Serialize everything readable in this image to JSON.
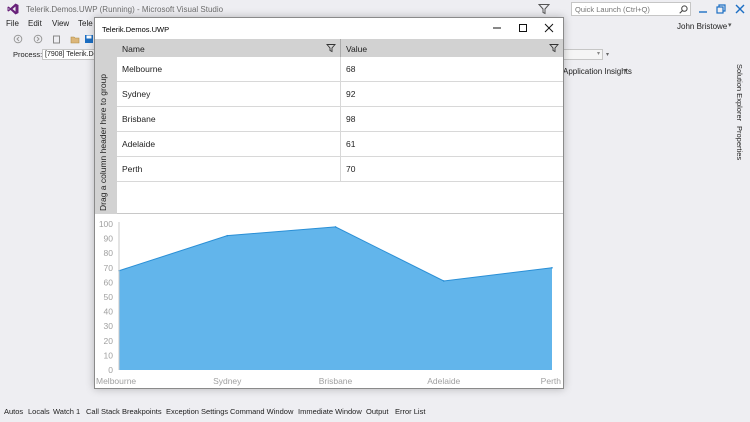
{
  "vs": {
    "title": "Telerik.Demos.UWP (Running) - Microsoft Visual Studio",
    "quick_launch_placeholder": "Quick Launch (Ctrl+Q)",
    "user": "John Bristowe",
    "menu": [
      "File",
      "Edit",
      "View",
      "Tele"
    ],
    "toolbar_partial_label": "Application Insights",
    "process_label": "Process:",
    "process_value": "[7908] Telerik.De",
    "side_tabs": [
      "Solution Explorer",
      "Properties"
    ],
    "bottom_tabs": [
      "Autos",
      "Locals",
      "Watch 1",
      "Call Stack",
      "Breakpoints",
      "Exception Settings",
      "Command Window",
      "Immediate Window",
      "Output",
      "Error List"
    ]
  },
  "app": {
    "title": "Telerik.Demos.UWP",
    "group_panel_text": "Drag a column header here to group",
    "grid": {
      "columns": [
        "Name",
        "Value"
      ],
      "rows": [
        [
          "Melbourne",
          "68"
        ],
        [
          "Sydney",
          "92"
        ],
        [
          "Brisbane",
          "98"
        ],
        [
          "Adelaide",
          "61"
        ],
        [
          "Perth",
          "70"
        ]
      ]
    }
  },
  "colors": {
    "area_fill": "#62b5eb",
    "area_stroke": "#2a8fd6",
    "axis_text": "#a0a0a0",
    "grid_header": "#d2d2d2"
  },
  "chart_data": {
    "type": "area",
    "categories": [
      "Melbourne",
      "Sydney",
      "Brisbane",
      "Adelaide",
      "Perth"
    ],
    "values": [
      68,
      92,
      98,
      61,
      70
    ],
    "ylim": [
      0,
      100
    ],
    "yticks": [
      0,
      10,
      20,
      30,
      40,
      50,
      60,
      70,
      80,
      90,
      100
    ],
    "grid": false
  }
}
